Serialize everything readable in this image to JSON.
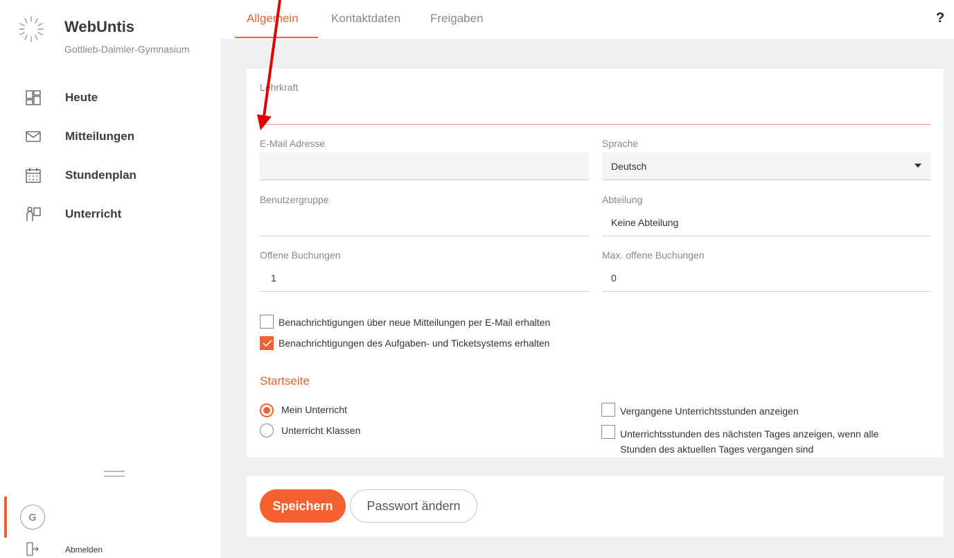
{
  "colors": {
    "accent": "#f4602f",
    "sidebar_bg": "#ffffff",
    "page_bg": "#f0f0f0",
    "annotation": "#e00000"
  },
  "sidebar": {
    "app_title": "WebUntis",
    "school": "Gottlieb-Daimler-Gymnasium",
    "items": [
      {
        "label": "Heute",
        "icon": "dashboard-icon"
      },
      {
        "label": "Mitteilungen",
        "icon": "mail-icon"
      },
      {
        "label": "Stundenplan",
        "icon": "calendar-icon"
      },
      {
        "label": "Unterricht",
        "icon": "teacher-icon"
      }
    ],
    "avatar_initial": "G",
    "logout_label": "Abmelden"
  },
  "tabs": [
    {
      "label": "Allgemein",
      "active": true
    },
    {
      "label": "Kontaktdaten",
      "active": false
    },
    {
      "label": "Freigaben",
      "active": false
    }
  ],
  "help_label": "?",
  "form": {
    "lehrkraft": {
      "label": "Lehrkraft",
      "value": ""
    },
    "email": {
      "label": "E-Mail Adresse",
      "value": ""
    },
    "sprache": {
      "label": "Sprache",
      "value": "Deutsch"
    },
    "benutzergruppe": {
      "label": "Benutzergruppe",
      "value": ""
    },
    "abteilung": {
      "label": "Abteilung",
      "value": "Keine Abteilung"
    },
    "offene_buchungen": {
      "label": "Offene Buchungen",
      "value": "1"
    },
    "max_offene_buchungen": {
      "label": "Max. offene Buchungen",
      "value": "0"
    },
    "notify_messages": {
      "label": "Benachrichtigungen über neue Mitteilungen per E-Mail erhalten",
      "checked": false
    },
    "notify_tickets": {
      "label": "Benachrichtigungen des Aufgaben- und Ticketsystems erhalten",
      "checked": true
    }
  },
  "startseite": {
    "title": "Startseite",
    "radios": [
      {
        "label": "Mein Unterricht",
        "selected": true
      },
      {
        "label": "Unterricht Klassen",
        "selected": false
      }
    ],
    "past_lessons": {
      "label": "Vergangene Unterrichtsstunden anzeigen",
      "checked": false
    },
    "next_day": {
      "label": "Unterrichtsstunden des nächsten Tages anzeigen, wenn alle Stunden des aktuellen Tages vergangen sind",
      "checked": false
    }
  },
  "buttons": {
    "save": "Speichern",
    "change_password": "Passwort ändern"
  }
}
